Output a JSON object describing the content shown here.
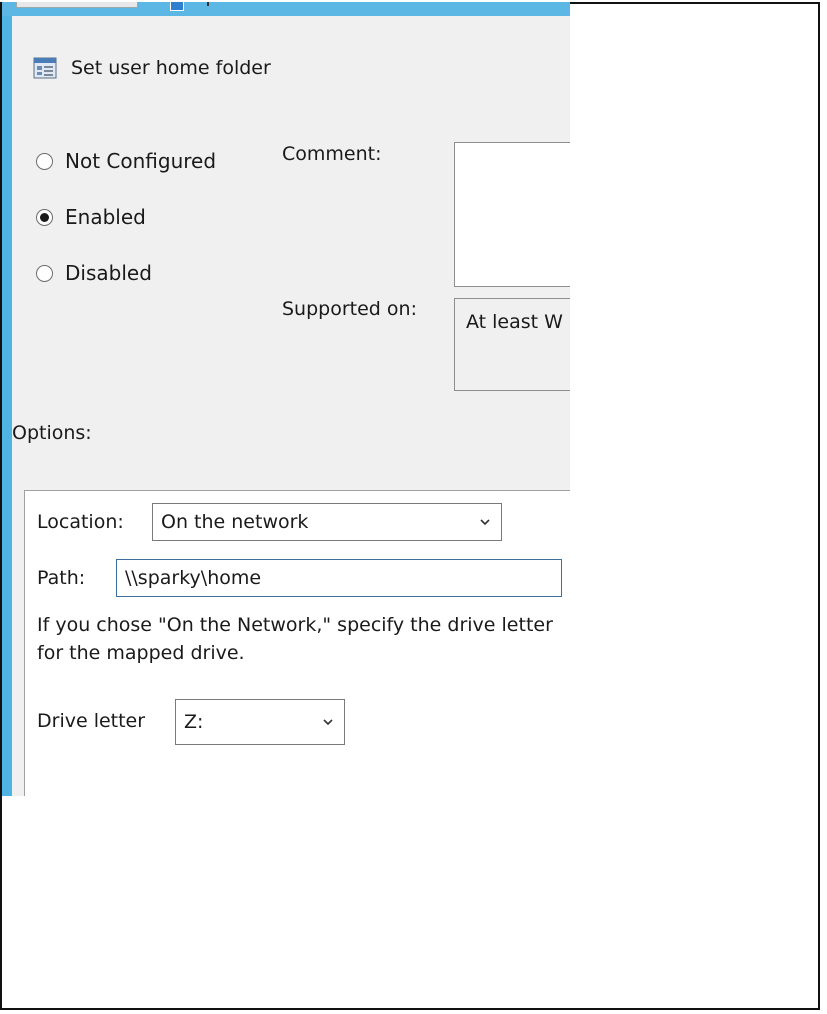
{
  "dialog": {
    "policy_title": "Set user home folder",
    "policy_icon": "policy-setting-icon"
  },
  "state": {
    "not_configured": "Not Configured",
    "enabled": "Enabled",
    "disabled": "Disabled",
    "selected": "Enabled"
  },
  "comment": {
    "label": "Comment:",
    "value": ""
  },
  "supported": {
    "label": "Supported on:",
    "value": "At least W"
  },
  "options": {
    "label": "Options:",
    "location_label": "Location:",
    "location_value": "On the network",
    "path_label": "Path:",
    "path_value": "\\\\sparky\\home",
    "help_text": "If you chose \"On the Network,\" specify the drive letter for the mapped drive.",
    "drive_label": "Drive letter",
    "drive_value": "Z:"
  },
  "colors": {
    "window_border": "#4fb3e3",
    "panel_bg": "#f0f0f0"
  }
}
